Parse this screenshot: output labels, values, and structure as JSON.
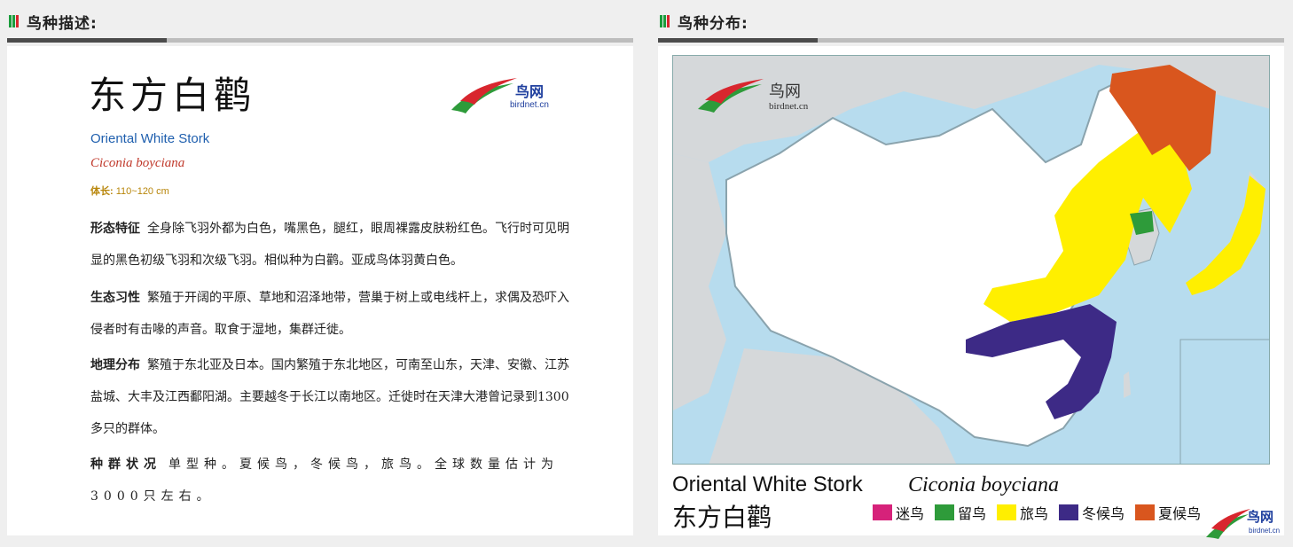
{
  "colors": {
    "flag_green": "#1a9c3c",
    "flag_red": "#d8262e",
    "accent_blue": "#1f5fae",
    "latin_red": "#c0392b",
    "legend_vagrant": "#d6227a",
    "legend_resident": "#2e9b3a",
    "legend_passage": "#ffef00",
    "legend_winter": "#3d2a86",
    "legend_summer": "#d9561e"
  },
  "left_section": {
    "heading": "鸟种描述:"
  },
  "right_section": {
    "heading": "鸟种分布:"
  },
  "description": {
    "title_cn": "东方白鹳",
    "name_en": "Oriental White Stork",
    "name_latin": "Ciconia boyciana",
    "length_label": "体长:",
    "length_value": "110~120   cm",
    "paragraphs": [
      {
        "key": "形态特征",
        "text": "全身除飞羽外都为白色，嘴黑色，腿红，眼周裸露皮肤粉红色。飞行时可见明显的黑色初级飞羽和次级飞羽。相似种为白鹳。亚成鸟体羽黄白色。"
      },
      {
        "key": "生态习性",
        "text": "繁殖于开阔的平原、草地和沼泽地带，营巢于树上或电线杆上，求偶及恐吓入侵者时有击喙的声音。取食于湿地，集群迁徙。"
      },
      {
        "key": "地理分布",
        "text": "繁殖于东北亚及日本。国内繁殖于东北地区，可南至山东，天津、安徽、江苏盐城、大丰及江西鄱阳湖。主要越冬于长江以南地区。迁徙时在天津大港曾记录到1300多只的群体。"
      },
      {
        "key": "种群状况",
        "text": "单型种。夏候鸟，冬候鸟，旅鸟。全球数量估计为3000只左右。"
      }
    ]
  },
  "logo": {
    "cn": "鸟网",
    "url": "birdnet.cn"
  },
  "map": {
    "name_en": "Oriental White Stork",
    "name_latin": "Ciconia boyciana",
    "name_cn": "东方白鹳",
    "legend": [
      {
        "label": "迷鸟",
        "color": "#d6227a"
      },
      {
        "label": "留鸟",
        "color": "#2e9b3a"
      },
      {
        "label": "旅鸟",
        "color": "#ffef00"
      },
      {
        "label": "冬候鸟",
        "color": "#3d2a86"
      },
      {
        "label": "夏候鸟",
        "color": "#d9561e"
      }
    ]
  }
}
